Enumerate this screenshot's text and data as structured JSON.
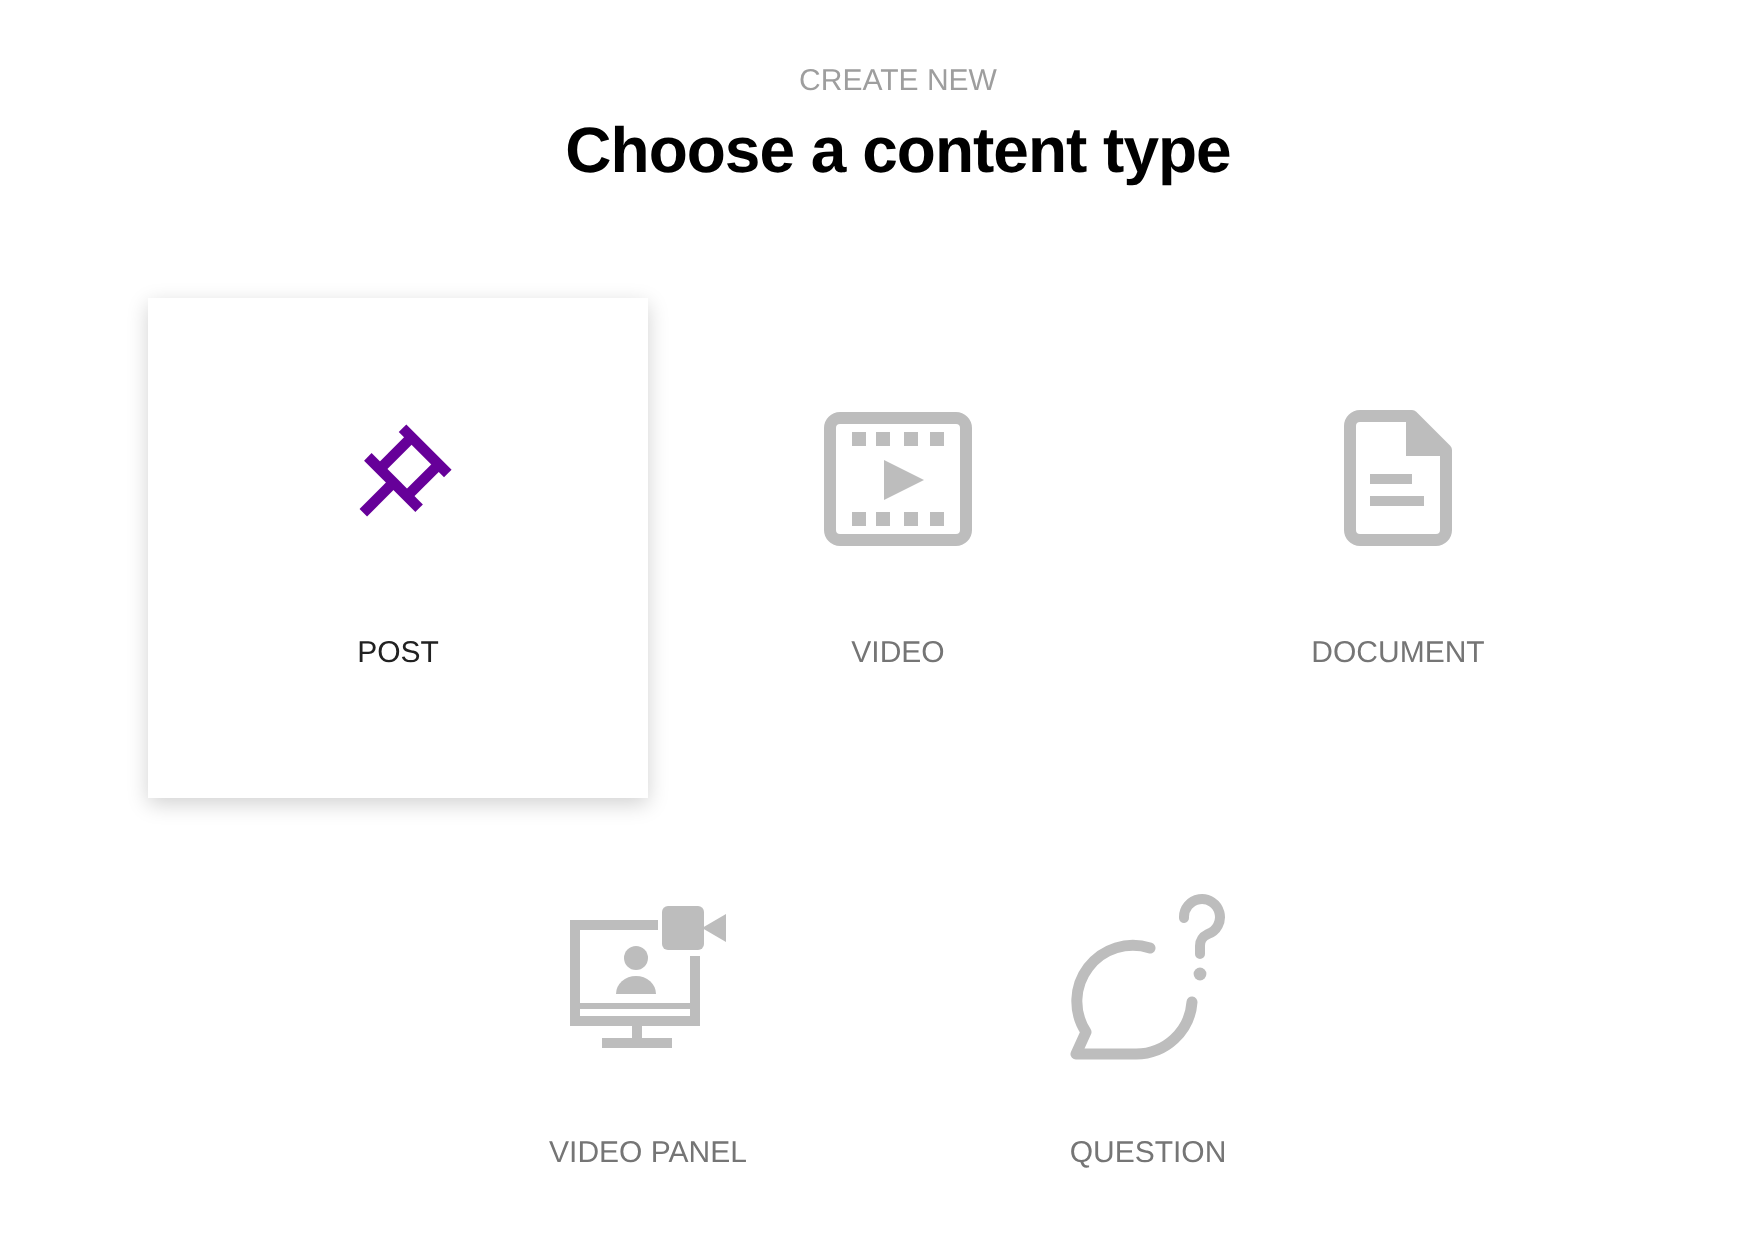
{
  "header": {
    "eyebrow": "CREATE NEW",
    "title": "Choose a content type"
  },
  "content_types": [
    {
      "label": "POST",
      "selected": true
    },
    {
      "label": "VIDEO",
      "selected": false
    },
    {
      "label": "DOCUMENT",
      "selected": false
    },
    {
      "label": "VIDEO PANEL",
      "selected": false
    },
    {
      "label": "QUESTION",
      "selected": false
    }
  ]
}
